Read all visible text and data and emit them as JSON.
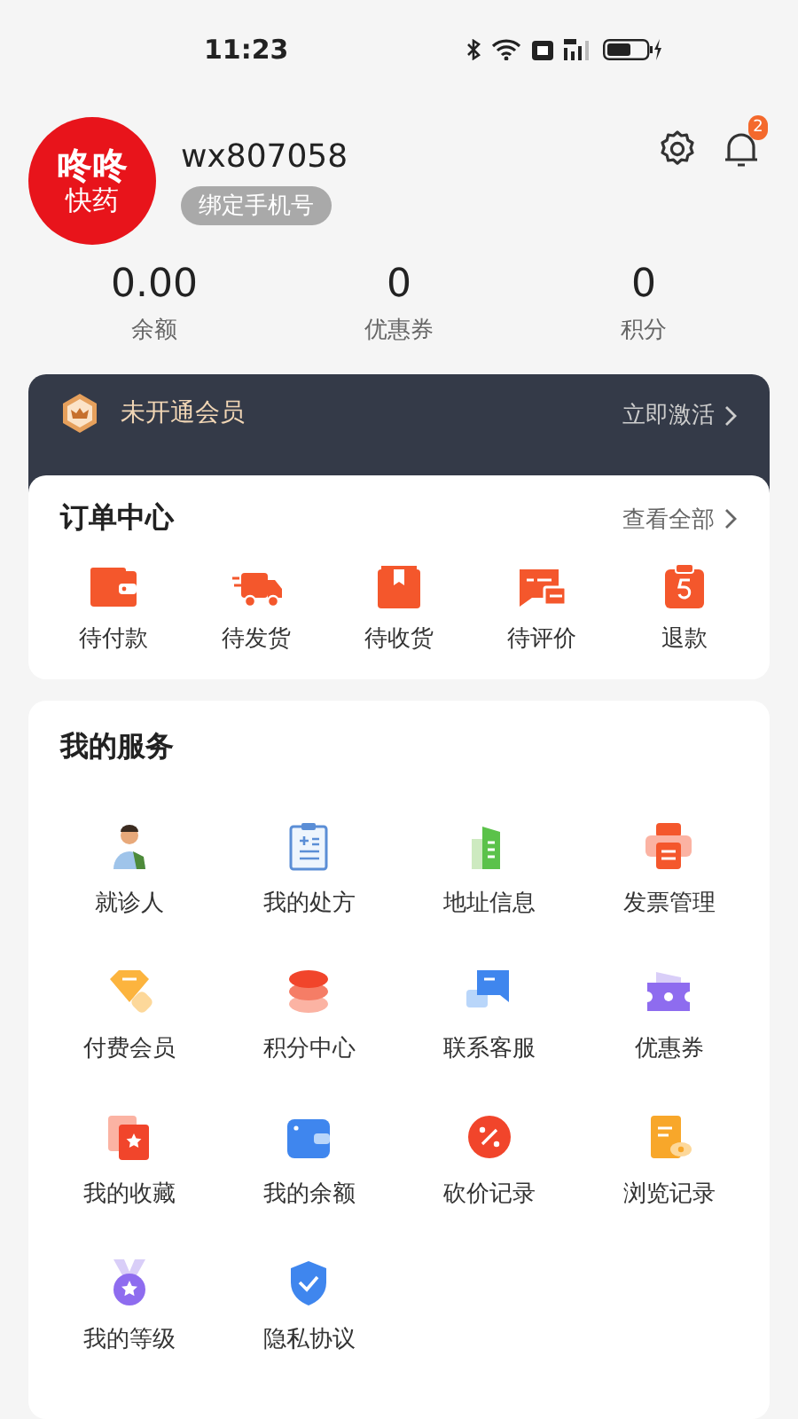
{
  "status_bar": {
    "time": "11:23"
  },
  "profile": {
    "avatar_top": "咚咚",
    "avatar_bottom": "快药",
    "username": "wx807058",
    "bind_phone": "绑定手机号",
    "notification_count": "2"
  },
  "stats": [
    {
      "value": "0.00",
      "label": "余额"
    },
    {
      "value": "0",
      "label": "优惠券"
    },
    {
      "value": "0",
      "label": "积分"
    }
  ],
  "membership": {
    "status": "未开通会员",
    "action": "立即激活"
  },
  "orders": {
    "title": "订单中心",
    "view_all": "查看全部",
    "items": [
      {
        "label": "待付款"
      },
      {
        "label": "待发货"
      },
      {
        "label": "待收货"
      },
      {
        "label": "待评价"
      },
      {
        "label": "退款"
      }
    ]
  },
  "services": {
    "title": "我的服务",
    "items": [
      {
        "label": "就诊人"
      },
      {
        "label": "我的处方"
      },
      {
        "label": "地址信息"
      },
      {
        "label": "发票管理"
      },
      {
        "label": "付费会员"
      },
      {
        "label": "积分中心"
      },
      {
        "label": "联系客服"
      },
      {
        "label": "优惠券"
      },
      {
        "label": "我的收藏"
      },
      {
        "label": "我的余额"
      },
      {
        "label": "砍价记录"
      },
      {
        "label": "浏览记录"
      },
      {
        "label": "我的等级"
      },
      {
        "label": "隐私协议"
      }
    ]
  }
}
